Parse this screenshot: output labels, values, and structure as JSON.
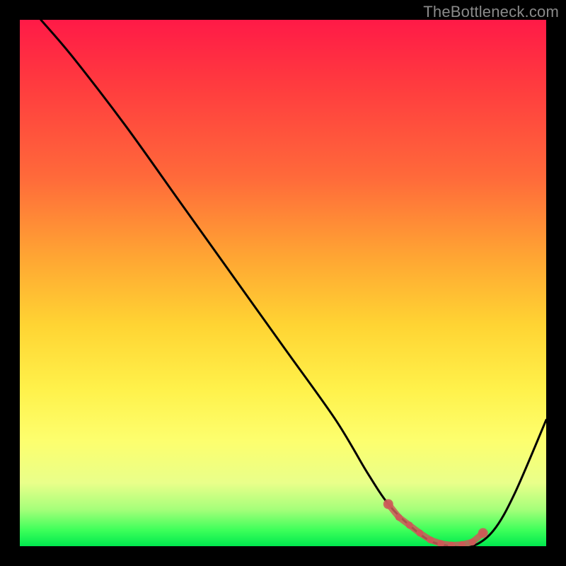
{
  "watermark": {
    "text": "TheBottleneck.com"
  },
  "colors": {
    "background": "#000000",
    "curve": "#000000",
    "marker": "#cc5a58",
    "watermark": "#8a8a8a"
  },
  "chart_data": {
    "type": "line",
    "title": "",
    "xlabel": "",
    "ylabel": "",
    "xlim": [
      0,
      100
    ],
    "ylim": [
      0,
      100
    ],
    "grid": false,
    "legend": false,
    "series": [
      {
        "name": "bottleneck-curve",
        "x": [
          4,
          10,
          20,
          30,
          40,
          50,
          60,
          66,
          70,
          74,
          78,
          82,
          86,
          90,
          94,
          100
        ],
        "y": [
          100,
          93,
          80,
          66,
          52,
          38,
          24,
          14,
          8,
          4,
          1,
          0,
          0,
          3,
          10,
          24
        ]
      }
    ],
    "markers": {
      "name": "optimal-range",
      "x": [
        70,
        72,
        74,
        76,
        78,
        80,
        82,
        84,
        86,
        88
      ],
      "y": [
        8,
        5.5,
        4,
        2.5,
        1.2,
        0.5,
        0.2,
        0.3,
        0.8,
        2.5
      ]
    }
  }
}
